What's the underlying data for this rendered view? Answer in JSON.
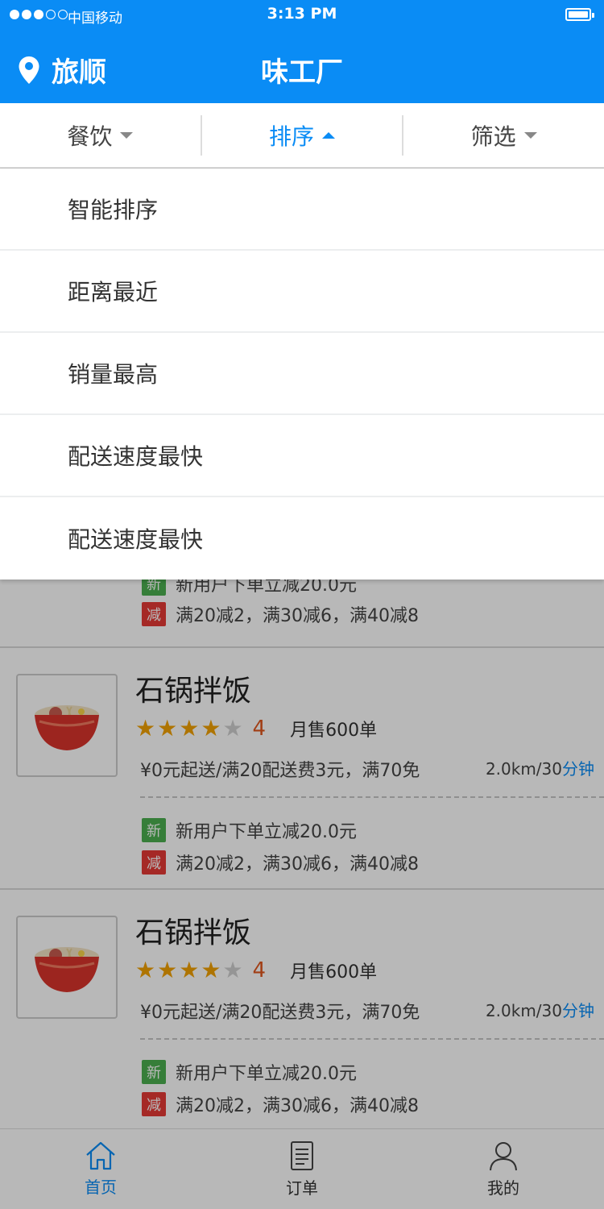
{
  "status": {
    "carrier": "中国移动",
    "time": "3:13 PM"
  },
  "header": {
    "location": "旅顺",
    "title": "味工厂"
  },
  "filters": [
    {
      "label": "餐饮",
      "active": false
    },
    {
      "label": "排序",
      "active": true
    },
    {
      "label": "筛选",
      "active": false
    }
  ],
  "sort_options": [
    "智能排序",
    "距离最近",
    "销量最高",
    "配送速度最快",
    "配送速度最快"
  ],
  "partial": {
    "promo_new": "新用户下单立减20.0元",
    "promo_discount": "满20减2，满30减6，满40减8"
  },
  "restaurants": [
    {
      "name": "石锅拌饭",
      "rating": 4,
      "monthly_sales": "月售600单",
      "delivery": "¥0元起送/满20配送费3元，满70免",
      "distance": "2.0km/30",
      "minute_unit": "分钟",
      "promo_new_tag": "新",
      "promo_new": "新用户下单立减20.0元",
      "promo_discount_tag": "减",
      "promo_discount": "满20减2，满30减6，满40减8"
    },
    {
      "name": "石锅拌饭",
      "rating": 4,
      "monthly_sales": "月售600单",
      "delivery": "¥0元起送/满20配送费3元，满70免",
      "distance": "2.0km/30",
      "minute_unit": "分钟",
      "promo_new_tag": "新",
      "promo_new": "新用户下单立减20.0元",
      "promo_discount_tag": "减",
      "promo_discount": "满20减2，满30减6，满40减8"
    }
  ],
  "nav": [
    {
      "label": "首页",
      "icon": "home-icon",
      "active": true
    },
    {
      "label": "订单",
      "icon": "order-icon",
      "active": false
    },
    {
      "label": "我的",
      "icon": "profile-icon",
      "active": false
    }
  ],
  "colors": {
    "primary": "#0A8CF5",
    "star": "#F2A102",
    "score": "#E0561E",
    "tag_new": "#4CAF50",
    "tag_discount": "#E53935"
  }
}
